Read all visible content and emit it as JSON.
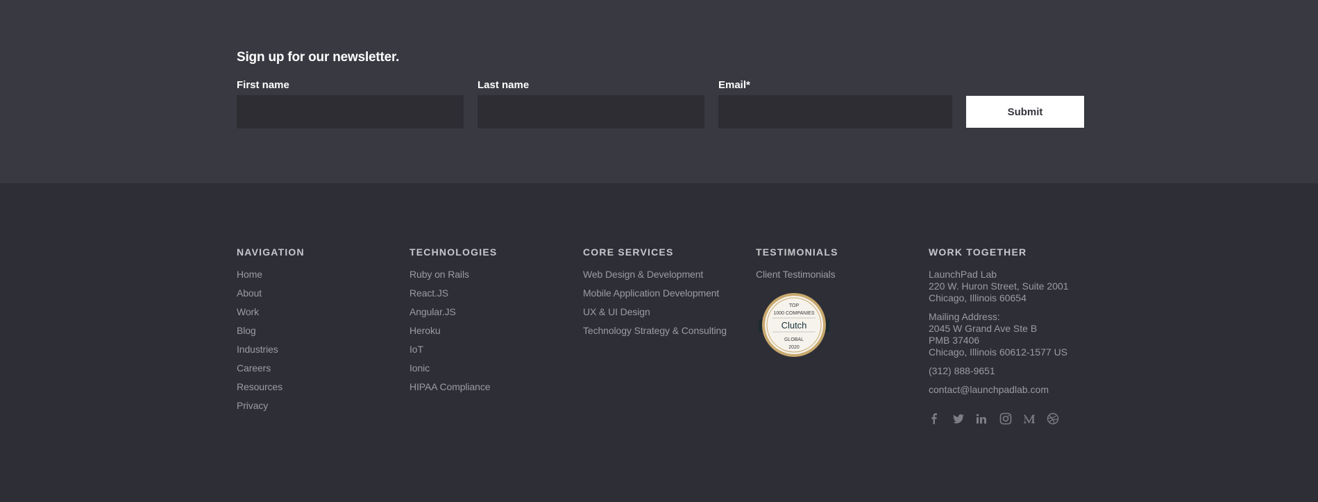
{
  "newsletter": {
    "title": "Sign up for our newsletter.",
    "first_name_label": "First name",
    "last_name_label": "Last name",
    "email_label": "Email*",
    "first_name_value": "",
    "last_name_value": "",
    "email_value": "",
    "submit_label": "Submit"
  },
  "footer": {
    "navigation": {
      "heading": "NAVIGATION",
      "items": [
        "Home",
        "About",
        "Work",
        "Blog",
        "Industries",
        "Careers",
        "Resources",
        "Privacy"
      ]
    },
    "technologies": {
      "heading": "TECHNOLOGIES",
      "items": [
        "Ruby on Rails",
        "React.JS",
        "Angular.JS",
        "Heroku",
        "IoT",
        "Ionic",
        "HIPAA Compliance"
      ]
    },
    "core_services": {
      "heading": "CORE SERVICES",
      "items": [
        "Web Design & Development",
        "Mobile Application Development",
        "UX & UI Design",
        "Technology Strategy & Consulting"
      ]
    },
    "testimonials": {
      "heading": "TESTIMONIALS",
      "items": [
        "Client Testimonials"
      ],
      "badge": {
        "top": "TOP",
        "line2": "1000 COMPANIES",
        "brand": "Clutch",
        "line4": "GLOBAL",
        "year": "2020"
      }
    },
    "work_together": {
      "heading": "WORK TOGETHER",
      "company": "LaunchPad Lab",
      "street": "220 W. Huron Street, Suite 2001",
      "city": "Chicago, Illinois 60654",
      "mailing_label": "Mailing Address:",
      "mailing_street": "2045 W Grand Ave Ste B",
      "mailing_pmb": "PMB 37406",
      "mailing_city": "Chicago, Illinois 60612-1577 US",
      "phone": "(312) 888-9651",
      "email": "contact@launchpadlab.com"
    },
    "social_icons": [
      "facebook-icon",
      "twitter-icon",
      "linkedin-icon",
      "instagram-icon",
      "medium-icon",
      "dribbble-icon"
    ]
  },
  "colors": {
    "newsletter_bg": "#393942",
    "footer_bg": "#2e2e36",
    "input_bg": "#2d2d33",
    "heading": "#c7c7cc",
    "link": "#9b9ba2",
    "badge_gold": "#c9a96e"
  }
}
